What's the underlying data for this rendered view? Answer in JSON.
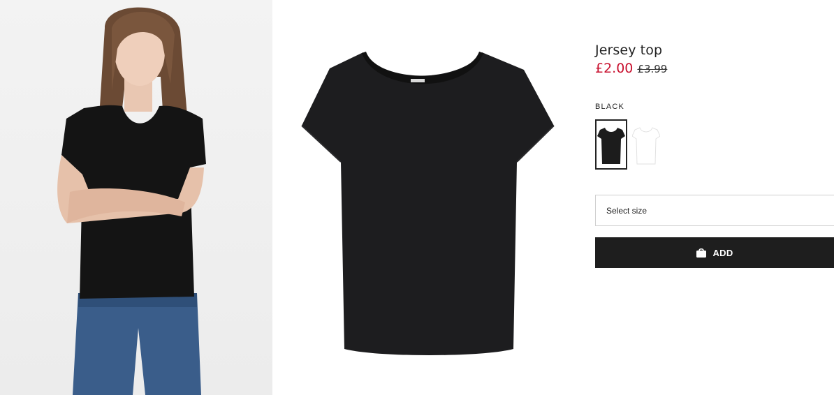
{
  "product": {
    "title": "Jersey top",
    "price_sale": "£2.00",
    "price_original": "£3.99",
    "color_selected": "BLACK",
    "swatches": [
      {
        "name": "black",
        "color": "#1c1c1c"
      },
      {
        "name": "white",
        "color": "#ffffff"
      }
    ]
  },
  "size_select": {
    "label": "Select size"
  },
  "add_button": {
    "label": "ADD",
    "icon": "shopping-bag-icon"
  },
  "colors": {
    "sale_price": "#c8102e",
    "button_bg": "#1e1e1e"
  }
}
